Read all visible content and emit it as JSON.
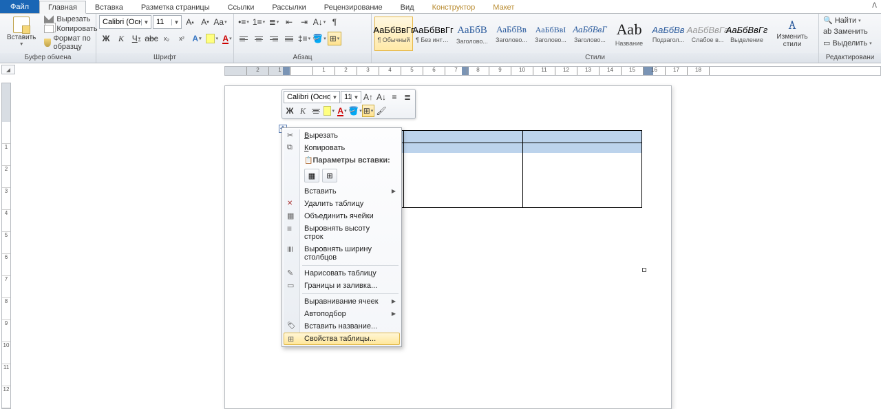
{
  "tabs": {
    "file": "Файл",
    "home": "Главная",
    "insert": "Вставка",
    "layout": "Разметка страницы",
    "refs": "Ссылки",
    "mail": "Рассылки",
    "review": "Рецензирование",
    "view": "Вид",
    "design": "Конструктор",
    "tlayout": "Макет"
  },
  "clipboard": {
    "paste": "Вставить",
    "cut": "Вырезать",
    "copy": "Копировать",
    "format": "Формат по образцу",
    "group": "Буфер обмена"
  },
  "font": {
    "name": "Calibri (Осно",
    "size": "11",
    "group": "Шрифт"
  },
  "paragraph": {
    "group": "Абзац"
  },
  "styles": {
    "group": "Стили",
    "change": "Изменить стили",
    "items": [
      {
        "sample": "АаБбВвГг",
        "name": "¶ Обычный",
        "sel": true,
        "cls": ""
      },
      {
        "sample": "АаБбВвГг",
        "name": "¶ Без инте...",
        "cls": ""
      },
      {
        "sample": "АаБбВ",
        "name": "Заголово...",
        "cls": "color:#2a5a9c;font-family:Cambria,serif;font-size:15px"
      },
      {
        "sample": "АаБбВв",
        "name": "Заголово...",
        "cls": "color:#2a5a9c;font-family:Cambria,serif;font-size:13px"
      },
      {
        "sample": "АаБбВвІ",
        "name": "Заголово...",
        "cls": "color:#2a5a9c;font-family:Cambria,serif;font-size:12px"
      },
      {
        "sample": "АаБбВвГ",
        "name": "Заголово...",
        "cls": "color:#2a5a9c;font-style:italic;font-family:Cambria,serif"
      },
      {
        "sample": "Ааb",
        "name": "Название",
        "cls": "font-family:Cambria,serif;font-size:22px;color:#222"
      },
      {
        "sample": "АаБбВв",
        "name": "Подзагол...",
        "cls": "color:#2a5a9c;font-style:italic"
      },
      {
        "sample": "АаБбВвГг",
        "name": "Слабое в...",
        "cls": "color:#999;font-style:italic"
      },
      {
        "sample": "АаБбВвГг",
        "name": "Выделение",
        "cls": "font-style:italic"
      }
    ]
  },
  "editing": {
    "find": "Найти",
    "replace": "Заменить",
    "select": "Выделить",
    "group": "Редактировани"
  },
  "mini": {
    "font": "Calibri (Основ",
    "size": "11"
  },
  "ctx": {
    "cut": "Вырезать",
    "copy": "Копировать",
    "pasteopts": "Параметры вставки:",
    "insert": "Вставить",
    "deltable": "Удалить таблицу",
    "merge": "Объединить ячейки",
    "rowh": "Выровнять высоту строк",
    "colw": "Выровнять ширину столбцов",
    "draw": "Нарисовать таблицу",
    "borders": "Границы и заливка...",
    "align": "Выравнивание ячеек",
    "autofit": "Автоподбор",
    "caption": "Вставить название...",
    "props": "Свойства таблицы..."
  }
}
